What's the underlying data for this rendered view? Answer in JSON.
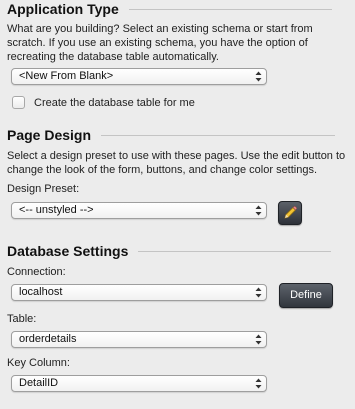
{
  "application_type": {
    "heading": "Application Type",
    "description": "What are you building? Select an existing schema or start from scratch. If you use an existing schema, you have the option of recreating the database table automatically.",
    "schema_select": {
      "value": "<New From Blank>"
    },
    "create_table_checkbox": {
      "label": "Create the database table for me",
      "checked": false
    }
  },
  "page_design": {
    "heading": "Page Design",
    "description": "Select a design preset to use with these pages. Use the edit button to change the look of the form, buttons, and change color settings.",
    "preset_label": "Design Preset:",
    "preset_select": {
      "value": "<-- unstyled -->"
    },
    "edit_button_icon": "pencil-icon"
  },
  "database_settings": {
    "heading": "Database Settings",
    "connection_label": "Connection:",
    "connection_select": {
      "value": "localhost"
    },
    "define_button": "Define",
    "table_label": "Table:",
    "table_select": {
      "value": "orderdetails"
    },
    "key_column_label": "Key Column:",
    "key_column_select": {
      "value": "DetailID"
    }
  }
}
